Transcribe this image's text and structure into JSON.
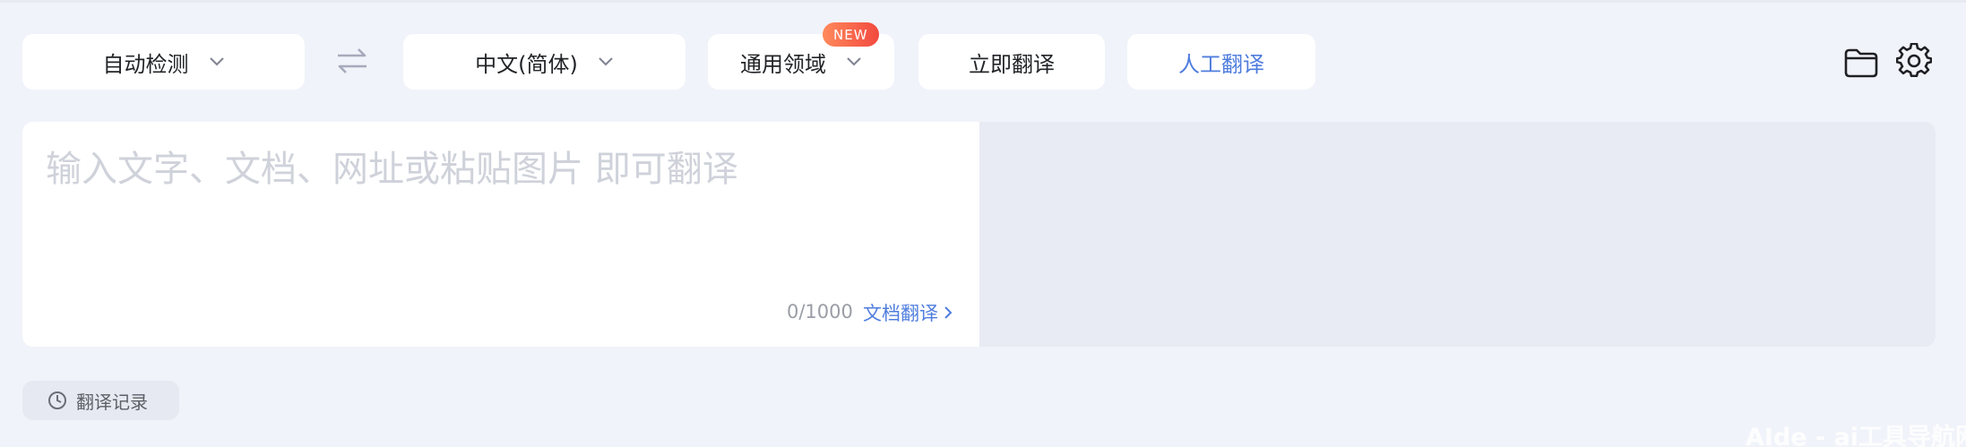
{
  "toolbar": {
    "source_lang": "自动检测",
    "target_lang": "中文(简体)",
    "domain": "通用领域",
    "domain_badge": "NEW",
    "translate_now": "立即翻译",
    "human_translate": "人工翻译"
  },
  "input": {
    "placeholder": "输入文字、文档、网址或粘贴图片 即可翻译",
    "counter": "0/1000",
    "doc_translate": "文档翻译"
  },
  "history": {
    "label": "翻译记录"
  },
  "watermark": "AIde - ai工具导航网",
  "icons": {
    "swap": "swap-arrows-icon",
    "folder": "folder-icon",
    "gear": "gear-icon",
    "clock": "clock-icon",
    "chevron": "chevron-down-icon"
  },
  "colors": {
    "background": "#f1f3fa",
    "accent": "#4f7dde",
    "badge_from": "#ff8a5c",
    "badge_to": "#f2493f",
    "output_panel": "#e8ebf3"
  }
}
